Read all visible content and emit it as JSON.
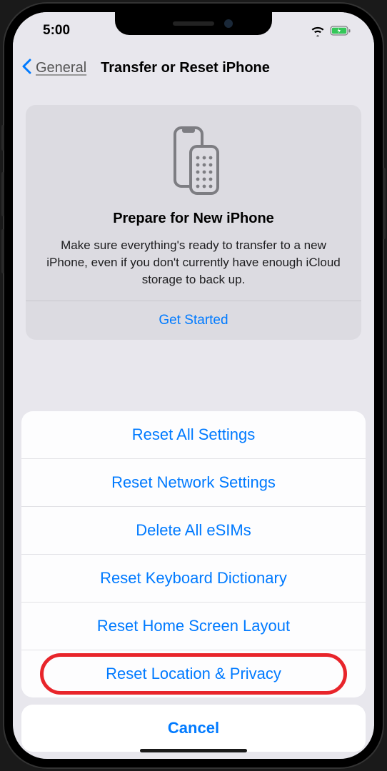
{
  "status": {
    "time": "5:00"
  },
  "nav": {
    "back_label": "General",
    "title": "Transfer or Reset iPhone"
  },
  "prepare_card": {
    "title": "Prepare for New iPhone",
    "description": "Make sure everything's ready to transfer to a new iPhone, even if you don't currently have enough iCloud storage to back up.",
    "action": "Get Started"
  },
  "sheet": {
    "items": [
      "Reset All Settings",
      "Reset Network Settings",
      "Delete All eSIMs",
      "Reset Keyboard Dictionary",
      "Reset Home Screen Layout",
      "Reset Location & Privacy"
    ],
    "cancel": "Cancel"
  }
}
